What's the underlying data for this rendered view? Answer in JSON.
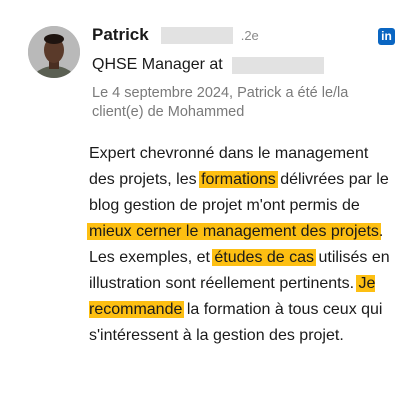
{
  "recommendation": {
    "author_name": "Patrick",
    "degree": ".2e",
    "headline": "QHSE Manager at",
    "date_line": "Le 4 septembre 2024, Patrick a été le/la client(e) de Mohammed",
    "icons": {
      "network": "linkedin-icon",
      "avatar": "person-photo"
    },
    "colors": {
      "highlight": "#fdbf12",
      "linkedin": "#0a66c2"
    },
    "text": {
      "p1": "Expert chevronné dans le management des projets, les ",
      "h1": "formations",
      "p2": " délivrées par le blog gestion de projet m'ont permis de ",
      "h2": "mieux cerner le management des projets",
      "p3": ". Les exemples, et ",
      "h3": "études de cas",
      "p4": " utilisés en illustration sont réellement pertinents. ",
      "h4": "Je recommande",
      "p5": " la formation à tous ceux qui s'intéressent à la gestion des projet."
    }
  }
}
